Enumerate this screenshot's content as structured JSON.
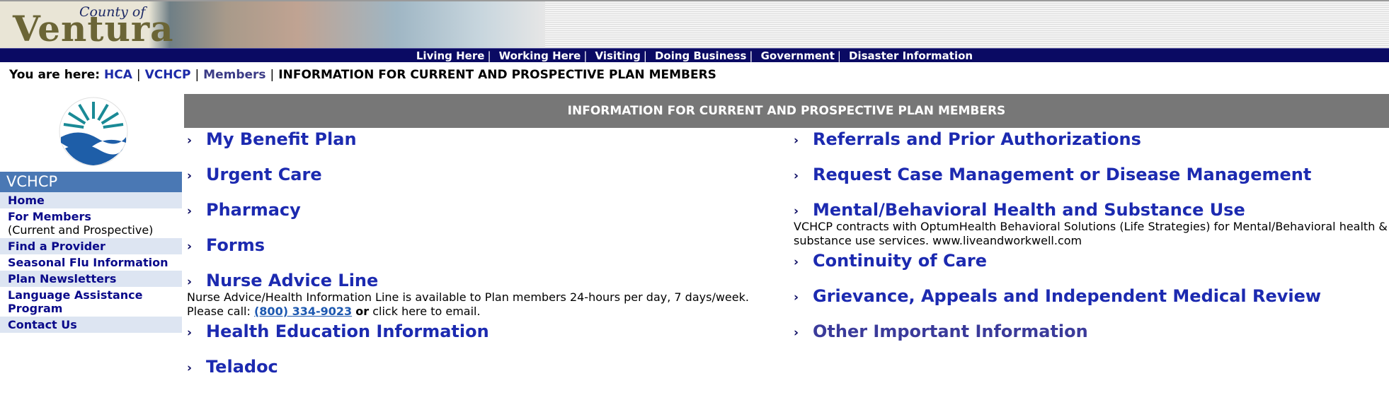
{
  "banner": {
    "county": "County of",
    "name": "Ventura"
  },
  "topnav": {
    "items": [
      "Living Here",
      "Working Here",
      "Visiting",
      "Doing Business",
      "Government",
      "Disaster Information"
    ]
  },
  "breadcrumb": {
    "prefix": "You are here:",
    "items": [
      "HCA",
      "VCHCP",
      "Members"
    ],
    "current": "INFORMATION FOR CURRENT AND PROSPECTIVE PLAN MEMBERS"
  },
  "sidebar": {
    "title": "VCHCP",
    "items": [
      {
        "label": "Home"
      },
      {
        "label": "For Members",
        "note": "(Current and Prospective)"
      },
      {
        "label": "Find a Provider"
      },
      {
        "label": "Seasonal Flu Information"
      },
      {
        "label": "Plan Newsletters"
      },
      {
        "label": "Language Assistance Program"
      },
      {
        "label": "Contact Us"
      }
    ]
  },
  "main": {
    "heading": "INFORMATION FOR CURRENT AND PROSPECTIVE PLAN MEMBERS",
    "left": [
      {
        "label": "My Benefit Plan"
      },
      {
        "label": "Urgent Care"
      },
      {
        "label": "Pharmacy"
      },
      {
        "label": "Forms"
      },
      {
        "label": "Nurse Advice Line"
      },
      {
        "label": "Health Education Information"
      },
      {
        "label": "Teladoc"
      }
    ],
    "nurse_desc": {
      "line1": "Nurse Advice/Health Information Line is available to Plan members 24-hours per day, 7 days/week.",
      "call_prefix": "Please call:",
      "phone": "(800) 334-9023",
      "or": "or",
      "email_text": "click here to email."
    },
    "right": [
      {
        "label": "Referrals and Prior Authorizations"
      },
      {
        "label": "Request Case Management or Disease Management"
      },
      {
        "label": "Mental/Behavioral Health and Substance Use"
      },
      {
        "label": "Continuity of Care"
      },
      {
        "label": "Grievance, Appeals and Independent Medical Review"
      },
      {
        "label": "Other Important Information"
      }
    ],
    "mental_desc": "VCHCP contracts with OptumHealth Behavioral Solutions (Life Strategies) for Mental/Behavioral health & substance use services. www.liveandworkwell.com",
    "chevron": "›"
  },
  "colors": {
    "navbar": "#0a0a63",
    "link": "#1c2ab0",
    "sidebar_title": "#4a78b4",
    "heading_bar": "#777777"
  }
}
